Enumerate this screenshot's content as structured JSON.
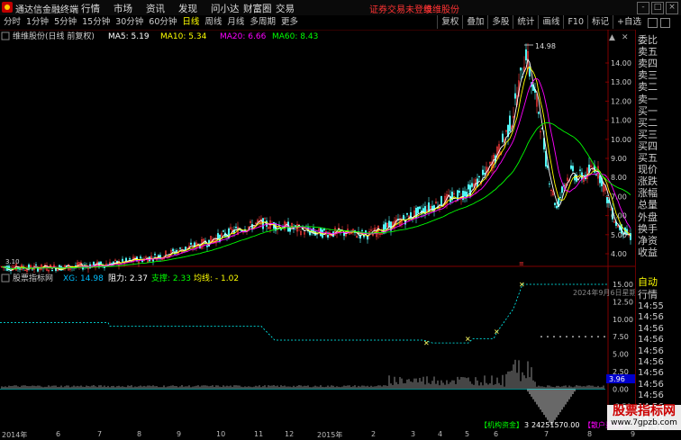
{
  "app": {
    "name": "通达信金融终端",
    "login_status": "证券交易未登录",
    "stock_name": "维维股份"
  },
  "menu": [
    "行情",
    "市场",
    "资讯",
    "发现",
    "问小达",
    "财富圈",
    "交易"
  ],
  "window_buttons": [
    "-",
    "□",
    "×"
  ],
  "periods": [
    {
      "label": "分时",
      "active": false
    },
    {
      "label": "1分钟",
      "active": false
    },
    {
      "label": "5分钟",
      "active": false
    },
    {
      "label": "15分钟",
      "active": false
    },
    {
      "label": "30分钟",
      "active": false
    },
    {
      "label": "60分钟",
      "active": false
    },
    {
      "label": "日线",
      "active": true
    },
    {
      "label": "周线",
      "active": false
    },
    {
      "label": "月线",
      "active": false
    },
    {
      "label": "多周期",
      "active": false
    },
    {
      "label": "更多",
      "active": false
    }
  ],
  "tools": [
    "复权",
    "叠加",
    "多股",
    "统计",
    "画线",
    "F10",
    "标记",
    "+自选"
  ],
  "main_chart": {
    "title": "维维股份(日线 前复权)",
    "ma": [
      {
        "label": "MA5: 5.19",
        "color": "#ffffff"
      },
      {
        "label": "MA10: 5.34",
        "color": "#ffff00"
      },
      {
        "label": "MA20: 6.66",
        "color": "#ff00ff"
      },
      {
        "label": "MA60: 8.43",
        "color": "#00ff00"
      }
    ],
    "high_label": "14.98",
    "low_label": "3.10",
    "yticks": [
      "14.00",
      "13.00",
      "12.00",
      "11.00",
      "10.00",
      "9.00",
      "8.00",
      "7.00",
      "6.00",
      "5.00",
      "4.00"
    ]
  },
  "indicator": {
    "title": "股票指标网",
    "items": [
      {
        "label": "XG: 14.98",
        "color": "#00bfff"
      },
      {
        "label": "阻力: 2.37",
        "color": "#ffffff"
      },
      {
        "label": "支撑: 2.33",
        "color": "#00ff00"
      },
      {
        "label": "均线: - 1.02",
        "color": "#ffff00"
      }
    ],
    "date_note": "2024年9月6日星期",
    "yticks": [
      "15.00",
      "12.50",
      "10.00",
      "7.50",
      "5.00",
      "2.50",
      "0.00",
      "-2.50",
      "-5.00"
    ],
    "current_value": "3.96",
    "legend_bottom": [
      {
        "label": "【机构资金】",
        "color": "#00ff00"
      },
      {
        "label": "3",
        "color": "#ffffff"
      },
      {
        "label": "24251570.00",
        "color": "#ffffff"
      },
      {
        "label": "【散户资金】",
        "color": "#ff00ff"
      }
    ]
  },
  "right_panel": {
    "items": [
      "委比",
      "卖五",
      "卖四",
      "卖三",
      "卖二",
      "卖一",
      "买一",
      "买二",
      "买三",
      "买四",
      "买五",
      "现价",
      "涨跌",
      "涨幅",
      "总量",
      "外盘",
      "换手",
      "净资",
      "收益"
    ],
    "sub_items": [
      "自动",
      "行情"
    ],
    "times": [
      "14:55",
      "14:56",
      "14:56",
      "14:56",
      "14:56",
      "14:56",
      "14:56",
      "14:56",
      "14:56",
      "14:56",
      "14:56",
      "14:56"
    ]
  },
  "x_axis": [
    "2014年",
    "6",
    "7",
    "8",
    "9",
    "10",
    "11",
    "12",
    "2015年",
    "2",
    "3",
    "4",
    "5",
    "6",
    "7",
    "8",
    "9"
  ],
  "watermark": "股票指标网",
  "watermark_url": "www.7gpzb.com"
}
